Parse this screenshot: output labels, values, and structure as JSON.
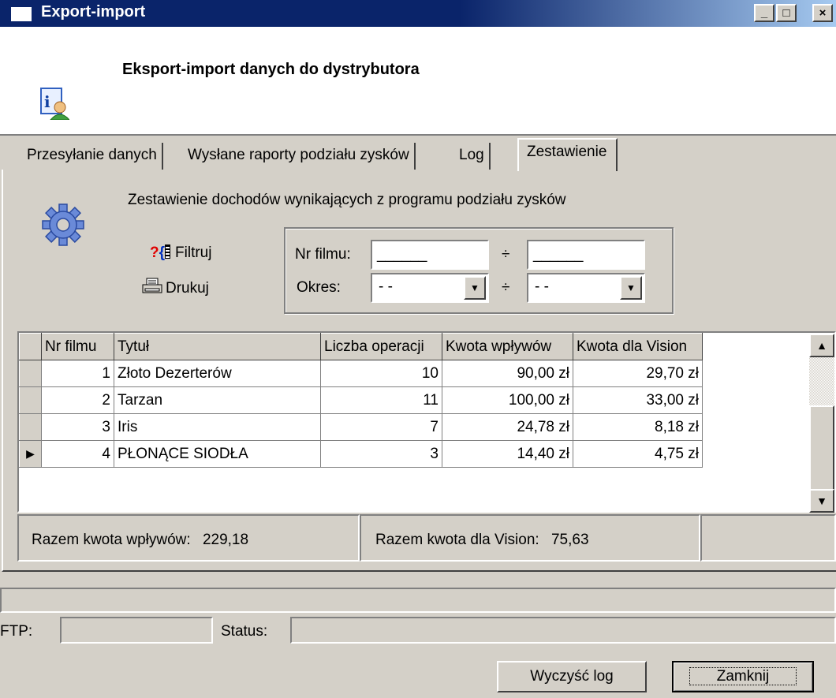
{
  "window": {
    "title": "Export-import",
    "controls": [
      "_",
      "□",
      "×"
    ]
  },
  "header": {
    "title": "Eksport-import danych do dystrybutora",
    "icon": "info-person-icon"
  },
  "tabs": [
    {
      "label": "Przesyłanie danych",
      "active": false
    },
    {
      "label": "Wysłane raporty podziału zysków",
      "active": false
    },
    {
      "label": "Log",
      "active": false
    },
    {
      "label": "Zestawienie",
      "active": true
    }
  ],
  "summary": {
    "title": "Zestawienie dochodów wynikających z programu podziału zysków",
    "filter_label": "Filtruj",
    "print_label": "Drukuj",
    "film_label": "Nr filmu:",
    "period_label": "Okres:",
    "range_sep": "÷",
    "film_from": "______",
    "film_to": "______",
    "period_from": "- -",
    "period_to": "- -"
  },
  "grid": {
    "columns": [
      "Nr filmu",
      "Tytuł",
      "Liczba operacji",
      "Kwota wpływów",
      "Kwota dla Vision"
    ],
    "rows": [
      {
        "nr": "1",
        "title": "Złoto Dezerterów",
        "ops": "10",
        "income": "90,00 zł",
        "vision": "29,70 zł",
        "current": false
      },
      {
        "nr": "2",
        "title": "Tarzan",
        "ops": "11",
        "income": "100,00 zł",
        "vision": "33,00 zł",
        "current": false
      },
      {
        "nr": "3",
        "title": "Iris",
        "ops": "7",
        "income": "24,78 zł",
        "vision": "8,18 zł",
        "current": false
      },
      {
        "nr": "4",
        "title": "PŁONĄCE SIODŁA",
        "ops": "3",
        "income": "14,40 zł",
        "vision": "4,75 zł",
        "current": true
      }
    ]
  },
  "totals": {
    "income_label": "Razem kwota wpływów:",
    "income_value": "229,18",
    "vision_label": "Razem kwota dla Vision:",
    "vision_value": "75,63"
  },
  "status": {
    "ftp_label": "FTP:",
    "status_label": "Status:"
  },
  "buttons": {
    "clear_log": "Wyczyść log",
    "close": "Zamknij"
  }
}
